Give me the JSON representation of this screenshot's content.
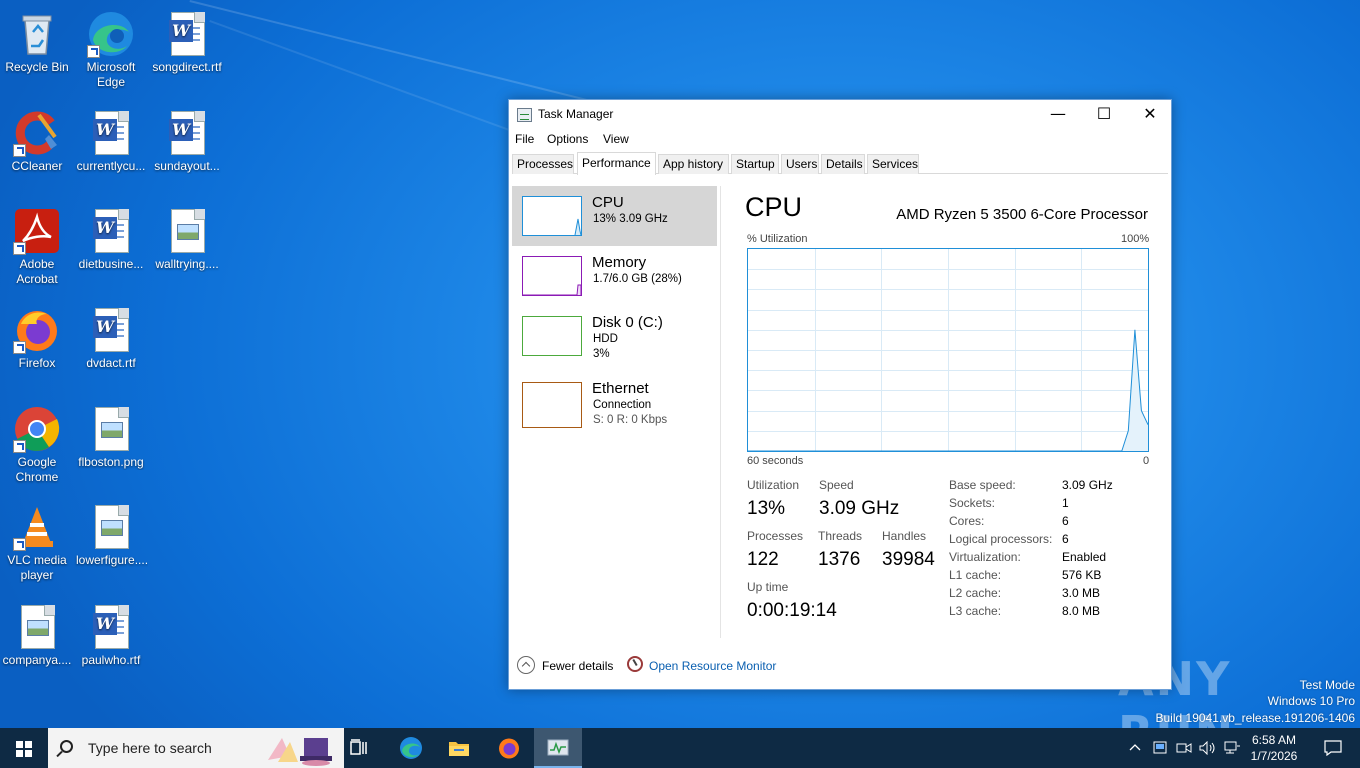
{
  "desktop": {
    "icons": [
      {
        "label": "Recycle Bin",
        "icon": "recycle-bin-icon"
      },
      {
        "label": "Microsoft Edge",
        "icon": "edge-icon"
      },
      {
        "label": "songdirect.rtf",
        "icon": "word-doc-icon"
      },
      {
        "label": "CCleaner",
        "icon": "ccleaner-icon"
      },
      {
        "label": "currentlycu...",
        "icon": "word-doc-icon"
      },
      {
        "label": "sundayout...",
        "icon": "word-doc-icon"
      },
      {
        "label": "Adobe Acrobat",
        "icon": "acrobat-icon"
      },
      {
        "label": "dietbusine...",
        "icon": "word-doc-icon"
      },
      {
        "label": "walltrying....",
        "icon": "image-file-icon"
      },
      {
        "label": "Firefox",
        "icon": "firefox-icon"
      },
      {
        "label": "dvdact.rtf",
        "icon": "word-doc-icon"
      },
      {
        "label": "Google Chrome",
        "icon": "chrome-icon"
      },
      {
        "label": "flboston.png",
        "icon": "image-file-icon"
      },
      {
        "label": "VLC media player",
        "icon": "vlc-icon"
      },
      {
        "label": "lowerfigure....",
        "icon": "image-file-icon"
      },
      {
        "label": "companya....",
        "icon": "image-file-icon"
      },
      {
        "label": "paulwho.rtf",
        "icon": "word-doc-icon"
      }
    ]
  },
  "window": {
    "title": "Task Manager",
    "controls": {
      "minimize": "—",
      "maximize": "☐",
      "close": "✕"
    },
    "menu": [
      "File",
      "Options",
      "View"
    ],
    "tabs": [
      "Processes",
      "Performance",
      "App history",
      "Startup",
      "Users",
      "Details",
      "Services"
    ],
    "active_tab": "Performance"
  },
  "perf_list": [
    {
      "name": "CPU",
      "sub1": "13% 3.09 GHz",
      "sub2": "",
      "color": "#1f8fd8"
    },
    {
      "name": "Memory",
      "sub1": "1.7/6.0 GB (28%)",
      "sub2": "",
      "color": "#8b1ab5"
    },
    {
      "name": "Disk 0 (C:)",
      "sub1": "HDD",
      "sub2": "3%",
      "color": "#4caa3c"
    },
    {
      "name": "Ethernet",
      "sub1": "Connection",
      "sub2": "S: 0 R: 0 Kbps",
      "color": "#a85a14"
    }
  ],
  "cpu": {
    "title": "CPU",
    "model": "AMD Ryzen 5 3500 6-Core Processor",
    "graph": {
      "y_label": "% Utilization",
      "y_max_label": "100%",
      "x_left_label": "60 seconds",
      "x_right_label": "0",
      "values": [
        0,
        0,
        0,
        0,
        0,
        0,
        0,
        0,
        0,
        0,
        0,
        0,
        0,
        0,
        0,
        0,
        0,
        0,
        0,
        0,
        0,
        0,
        0,
        0,
        0,
        0,
        0,
        0,
        0,
        0,
        0,
        0,
        0,
        0,
        0,
        0,
        0,
        0,
        0,
        0,
        0,
        0,
        0,
        0,
        0,
        0,
        0,
        0,
        0,
        0,
        0,
        0,
        0,
        0,
        0,
        0,
        0,
        0,
        10,
        60,
        20,
        13
      ]
    },
    "stats": {
      "utilization_label": "Utilization",
      "utilization": "13%",
      "speed_label": "Speed",
      "speed": "3.09 GHz",
      "processes_label": "Processes",
      "processes": "122",
      "threads_label": "Threads",
      "threads": "1376",
      "handles_label": "Handles",
      "handles": "39984",
      "uptime_label": "Up time",
      "uptime": "0:00:19:14"
    },
    "specs": [
      {
        "k": "Base speed:",
        "v": "3.09 GHz"
      },
      {
        "k": "Sockets:",
        "v": "1"
      },
      {
        "k": "Cores:",
        "v": "6"
      },
      {
        "k": "Logical processors:",
        "v": "6"
      },
      {
        "k": "Virtualization:",
        "v": "Enabled"
      },
      {
        "k": "L1 cache:",
        "v": "576 KB"
      },
      {
        "k": "L2 cache:",
        "v": "3.0 MB"
      },
      {
        "k": "L3 cache:",
        "v": "8.0 MB"
      }
    ]
  },
  "footer": {
    "fewer_details": "Fewer details",
    "resource_monitor": "Open Resource Monitor"
  },
  "watermark": {
    "brand": "ANY RUN",
    "line1": "Test Mode",
    "line2": "Windows 10 Pro",
    "line3": "Build 19041.vb_release.191206-1406"
  },
  "taskbar": {
    "search_placeholder": "Type here to search",
    "time": "6:58 AM",
    "date": "1/7/2026"
  }
}
